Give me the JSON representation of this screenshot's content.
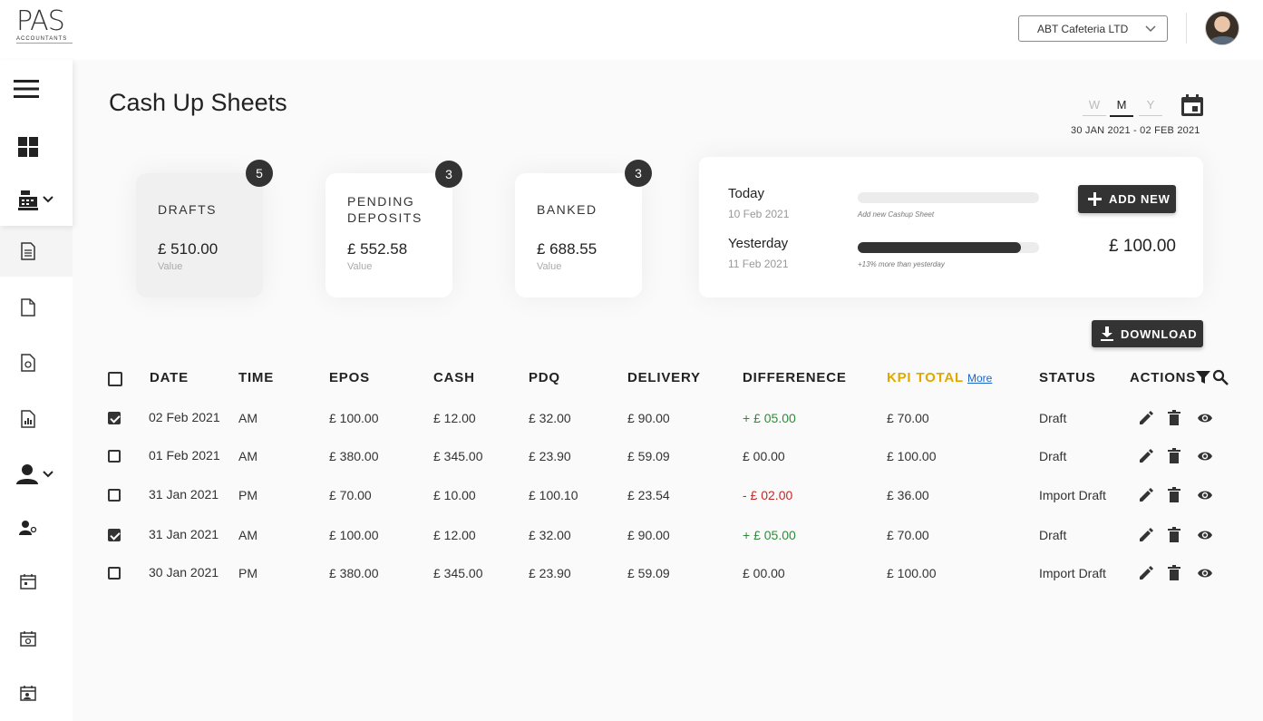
{
  "header": {
    "logo_text": "PAS",
    "logo_sub": "ACCOUNTANTS",
    "company_select": "ABT Cafeteria LTD"
  },
  "sidebar": {
    "items": [
      {
        "icon": "menu-icon"
      },
      {
        "icon": "dashboard-icon"
      },
      {
        "icon": "cash-register-icon",
        "expand": "chevron-down-icon"
      },
      {
        "icon": "document-icon"
      },
      {
        "icon": "file-icon"
      },
      {
        "icon": "file-money-icon"
      },
      {
        "icon": "file-chart-icon"
      },
      {
        "icon": "user-icon",
        "expand": "chevron-down-icon"
      },
      {
        "icon": "users-manage-icon"
      },
      {
        "icon": "calendar-icon"
      },
      {
        "icon": "calendar-settings-icon"
      },
      {
        "icon": "calendar-user-icon"
      }
    ]
  },
  "page": {
    "title": "Cash Up Sheets",
    "period_tabs": [
      "W",
      "M",
      "Y"
    ],
    "active_period": "M",
    "date_range": "30 JAN 2021 - 02 FEB 2021"
  },
  "stats": [
    {
      "label": "DRAFTS",
      "value": "£ 510.00",
      "sub": "Value",
      "count": "5"
    },
    {
      "label": "PENDING DEPOSITS",
      "value": "£ 552.58",
      "sub": "Value",
      "count": "3"
    },
    {
      "label": "BANKED",
      "value": "£ 688.55",
      "sub": "Value",
      "count": "3"
    }
  ],
  "comparison": {
    "today_label": "Today",
    "today_date": "10 Feb 2021",
    "today_note": "Add new Cashup Sheet",
    "today_progress": 0,
    "yesterday_label": "Yesterday",
    "yesterday_date": "11 Feb 2021",
    "yesterday_note": "+13% more than yesterday",
    "yesterday_progress": 0.9,
    "add_new_label": "ADD NEW",
    "amount": "£ 100.00"
  },
  "download_label": "DOWNLOAD",
  "table": {
    "columns": [
      "DATE",
      "TIME",
      "EPOS",
      "CASH",
      "PDQ",
      "DELIVERY",
      "DIFFERENECE",
      "KPI TOTAL",
      "STATUS",
      "ACTIONS"
    ],
    "kpi_more": "More",
    "rows": [
      {
        "checked": true,
        "date": "02 Feb 2021",
        "time": "AM",
        "epos": "£ 100.00",
        "cash": "£ 12.00",
        "pdq": "£ 32.00",
        "delivery": "£ 90.00",
        "difference": "+ £ 05.00",
        "diff_sign": "pos",
        "kpi": "£ 70.00",
        "status": "Draft"
      },
      {
        "checked": false,
        "date": "01 Feb 2021",
        "time": "AM",
        "epos": "£ 380.00",
        "cash": "£ 345.00",
        "pdq": "£ 23.90",
        "delivery": "£ 59.09",
        "difference": "£ 00.00",
        "diff_sign": "zero",
        "kpi": "£ 100.00",
        "status": "Draft"
      },
      {
        "checked": false,
        "date": "31 Jan 2021",
        "time": "PM",
        "epos": "£ 70.00",
        "cash": "£ 10.00",
        "pdq": "£ 100.10",
        "delivery": "£ 23.54",
        "difference": "- £ 02.00",
        "diff_sign": "neg",
        "kpi": "£ 36.00",
        "status": "Import Draft"
      },
      {
        "checked": true,
        "date": "31 Jan 2021",
        "time": "AM",
        "epos": "£ 100.00",
        "cash": "£ 12.00",
        "pdq": "£ 32.00",
        "delivery": "£ 90.00",
        "difference": "+ £ 05.00",
        "diff_sign": "pos",
        "kpi": "£ 70.00",
        "status": "Draft"
      },
      {
        "checked": false,
        "date": "30 Jan 2021",
        "time": "PM",
        "epos": "£ 380.00",
        "cash": "£ 345.00",
        "pdq": "£ 23.90",
        "delivery": "£ 59.09",
        "difference": "£ 00.00",
        "diff_sign": "zero",
        "kpi": "£ 100.00",
        "status": "Import Draft"
      }
    ]
  },
  "colors": {
    "accent": "#e0a800",
    "positive": "#2e8b3a",
    "negative": "#c62828",
    "dark": "#333333"
  }
}
